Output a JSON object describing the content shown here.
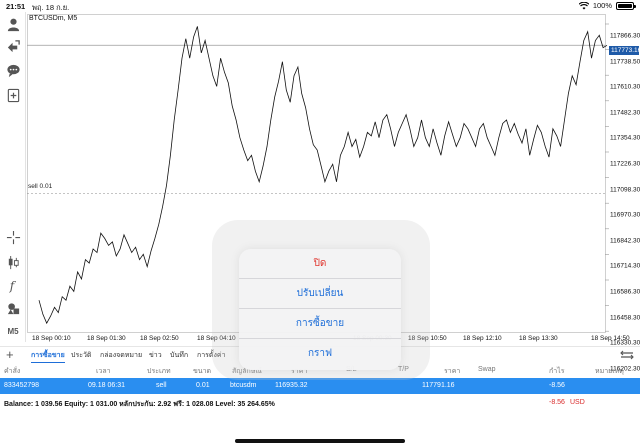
{
  "status_bar": {
    "time": "21:51",
    "date": "พฤ. 18 ก.ย.",
    "battery": "100%"
  },
  "toolbar": {
    "timeframe": "M5"
  },
  "chart": {
    "symbol_label": "BTCUSDm, M5",
    "sell_label": "sell 0.01",
    "current_price": "117773.16",
    "y_ticks": [
      "117866.30",
      "117738.50",
      "117610.30",
      "117482.30",
      "117354.30",
      "117226.30",
      "117098.30",
      "116970.30",
      "116842.30",
      "116714.30",
      "116586.30",
      "116458.30",
      "116330.30",
      "116202.30"
    ],
    "x_ticks": [
      "18 Sep 00:10",
      "18 Sep 01:30",
      "18 Sep 02:50",
      "18 Sep 04:10",
      "18 Sep 09:30",
      "18 Sep 10:50",
      "18 Sep 12:10",
      "18 Sep 13:30",
      "18 Sep 14:50"
    ]
  },
  "tabs": [
    "การซื้อขาย",
    "ประวัติ",
    "กล่องจดหมาย",
    "ข่าว",
    "บันทึก",
    "การตั้งค่า"
  ],
  "table": {
    "headers": [
      "คำสั่ง",
      "เวลา",
      "ประเภท",
      "ขนาด",
      "สัญลักษณ์",
      "ราคา",
      "S/L",
      "T/P",
      "ราคา",
      "Swap",
      "กำไร",
      "หมายเหตุ"
    ],
    "row": {
      "order": "833452798",
      "time": "09.18 06:31",
      "type": "sell",
      "volume": "0.01",
      "symbol": "btcusdm",
      "open_price": "116935.32",
      "price": "117791.16",
      "profit": "-8.56"
    }
  },
  "footer": {
    "summary": "Balance: 1 039.56 Equity: 1 031.00 หลักประกัน: 2.92 ฟรี: 1 028.08 Level: 35 264.65%",
    "profit": "-8.56",
    "currency": "USD"
  },
  "context_menu": {
    "items": [
      "ปิด",
      "ปรับเปลี่ยน",
      "การซื้อขาย",
      "กราฟ"
    ]
  },
  "colors": {
    "accent": "#1e6ed8",
    "close": "#e0362f",
    "row_highlight": "#2a8ef0",
    "price_tag": "#1e5aa8"
  },
  "chart_data": {
    "type": "line",
    "series": [
      {
        "values": [
          116330,
          116250,
          116200,
          116240,
          116290,
          116260,
          116350,
          116330,
          116410,
          116380,
          116490,
          116450,
          116560,
          116540,
          116620,
          116600,
          116710,
          116680,
          116640,
          116660,
          116580,
          116620,
          116700,
          116650,
          116600,
          116630,
          116560,
          116590,
          116520,
          116610,
          116680,
          116760,
          116860,
          116980,
          117150,
          117350,
          117520,
          117700,
          117810,
          117700,
          117820,
          117880,
          117730,
          117800,
          117700,
          117600,
          117540,
          117700,
          117620,
          117560,
          117430,
          117350,
          117250,
          117180,
          117120,
          117150,
          117060,
          117000,
          117090,
          117200,
          117350,
          117480,
          117570,
          117680,
          117520,
          117450,
          117600,
          117650,
          117500,
          117420,
          117300,
          117210,
          117180,
          117090,
          117000,
          117060,
          117100,
          117000,
          117150,
          117200,
          117280,
          117200,
          117240,
          117140,
          117200,
          117280,
          117260,
          117340,
          117250,
          117350,
          117380,
          117300,
          117200,
          117280,
          117330,
          117380,
          117300,
          117200,
          117250,
          117350,
          117250,
          117200,
          117300,
          117220,
          117150,
          117260,
          117340,
          117270,
          117200,
          117250,
          117330,
          117300,
          117250,
          117200,
          117300,
          117330,
          117250,
          117200,
          117150,
          117250,
          117330,
          117350,
          117280,
          117330,
          117270,
          117220,
          117300,
          117150,
          117240,
          117320,
          117280,
          117200,
          117140,
          117300,
          117260,
          117200,
          117350,
          117500,
          117600,
          117550,
          117680,
          117800,
          117850,
          117700,
          117800,
          117830,
          117760,
          117773
        ]
      }
    ],
    "ylim": [
      116150,
      117950
    ],
    "x_ticks": [
      "18 Sep 00:10",
      "18 Sep 01:30",
      "18 Sep 02:50",
      "18 Sep 04:10",
      "18 Sep 09:30",
      "18 Sep 10:50",
      "18 Sep 12:10",
      "18 Sep 13:30",
      "18 Sep 14:50"
    ],
    "current_price": 117773.16,
    "sell_level": 116935.32
  }
}
